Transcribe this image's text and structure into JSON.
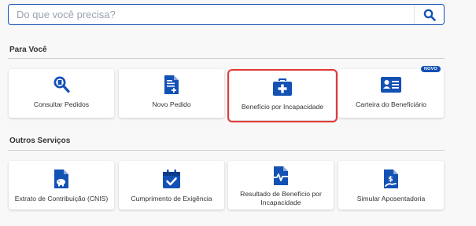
{
  "search": {
    "placeholder": "Do que você precisa?",
    "value": ""
  },
  "colors": {
    "accent": "#1351b4",
    "highlight_border": "#e53935"
  },
  "sections": [
    {
      "title": "Para Você",
      "cards": [
        {
          "label": "Consultar Pedidos",
          "icon": "search-document-icon"
        },
        {
          "label": "Novo Pedido",
          "icon": "new-document-icon"
        },
        {
          "label": "Benefício por Incapacidade",
          "icon": "medical-bag-icon",
          "highlighted": true
        },
        {
          "label": "Carteira do Beneficiário",
          "icon": "id-card-icon",
          "badge": "NOVO"
        }
      ]
    },
    {
      "title": "Outros Serviços",
      "cards": [
        {
          "label": "Extrato de Contribuição (CNIS)",
          "icon": "piggy-bank-document-icon"
        },
        {
          "label": "Cumprimento de Exigência",
          "icon": "calendar-check-icon"
        },
        {
          "label": "Resultado de Benefício por Incapacidade",
          "icon": "pulse-document-icon"
        },
        {
          "label": "Simular Aposentadoria",
          "icon": "money-hand-document-icon"
        }
      ]
    }
  ]
}
